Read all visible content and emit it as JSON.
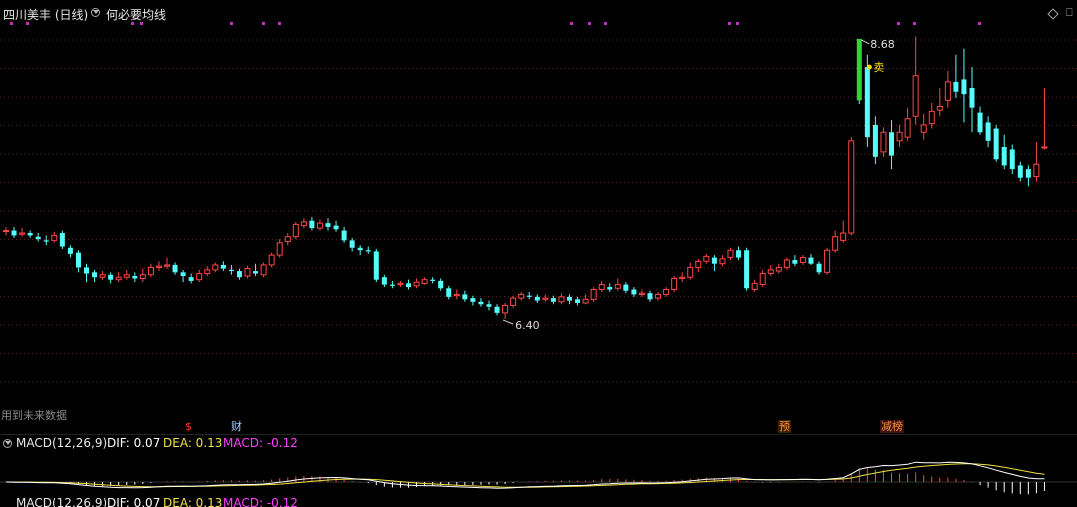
{
  "header": {
    "title": "四川美丰 (日线)",
    "indicator_name": "何必要均线"
  },
  "annotations": {
    "high_price": "8.68",
    "low_price": "6.40",
    "sell_marker": "卖",
    "future_data_note": "用到未来数据",
    "event_s": "$",
    "event_cai": "财",
    "event_yu": "预",
    "event_bang": "减榜"
  },
  "macd": {
    "name": "MACD(12,26,9)",
    "dif_label": "DIF: 0.07",
    "dea_label": "DEA: 0.13",
    "macd_label": "MACD: -0.12"
  },
  "colors": {
    "up": "#ff4545",
    "down": "#54fcfc",
    "highlight": "#2fd62f",
    "dif": "#ffffff",
    "dea": "#f0e040",
    "macd": "#ff40ff",
    "grid": "#5a2020",
    "purple_marks": "#c030c0"
  },
  "chart_data": {
    "type": "candlestick",
    "title": "四川美丰 (日线)",
    "high_label": 8.68,
    "low_label": 6.4,
    "price_range": [
      5.7,
      8.85
    ],
    "candles": [
      [
        7.12,
        7.12,
        7.15,
        7.08
      ],
      [
        7.12,
        7.08,
        7.15,
        7.06
      ],
      [
        7.09,
        7.1,
        7.14,
        7.07
      ],
      [
        7.1,
        7.08,
        7.12,
        7.06
      ],
      [
        7.07,
        7.05,
        7.1,
        7.03
      ],
      [
        7.04,
        7.03,
        7.08,
        7.0
      ],
      [
        7.04,
        7.08,
        7.11,
        7.02
      ],
      [
        7.1,
        6.99,
        7.12,
        6.97
      ],
      [
        6.98,
        6.93,
        7.0,
        6.9
      ],
      [
        6.94,
        6.82,
        6.96,
        6.78
      ],
      [
        6.82,
        6.77,
        6.85,
        6.7
      ],
      [
        6.78,
        6.74,
        6.8,
        6.7
      ],
      [
        6.74,
        6.76,
        6.79,
        6.72
      ],
      [
        6.76,
        6.72,
        6.78,
        6.69
      ],
      [
        6.72,
        6.74,
        6.78,
        6.7
      ],
      [
        6.74,
        6.76,
        6.8,
        6.72
      ],
      [
        6.75,
        6.73,
        6.78,
        6.7
      ],
      [
        6.73,
        6.76,
        6.81,
        6.7
      ],
      [
        6.76,
        6.82,
        6.85,
        6.74
      ],
      [
        6.82,
        6.83,
        6.87,
        6.79
      ],
      [
        6.83,
        6.84,
        6.9,
        6.81
      ],
      [
        6.84,
        6.78,
        6.86,
        6.76
      ],
      [
        6.78,
        6.75,
        6.8,
        6.7
      ],
      [
        6.74,
        6.71,
        6.77,
        6.69
      ],
      [
        6.72,
        6.77,
        6.8,
        6.7
      ],
      [
        6.77,
        6.8,
        6.83,
        6.75
      ],
      [
        6.8,
        6.84,
        6.86,
        6.78
      ],
      [
        6.84,
        6.81,
        6.87,
        6.79
      ],
      [
        6.8,
        6.79,
        6.84,
        6.76
      ],
      [
        6.79,
        6.74,
        6.81,
        6.72
      ],
      [
        6.75,
        6.81,
        6.83,
        6.73
      ],
      [
        6.79,
        6.77,
        6.85,
        6.75
      ],
      [
        6.76,
        6.84,
        6.86,
        6.74
      ],
      [
        6.84,
        6.92,
        6.94,
        6.82
      ],
      [
        6.92,
        7.02,
        7.05,
        6.9
      ],
      [
        7.03,
        7.07,
        7.1,
        7.0
      ],
      [
        7.07,
        7.17,
        7.19,
        7.05
      ],
      [
        7.16,
        7.19,
        7.22,
        7.14
      ],
      [
        7.2,
        7.14,
        7.23,
        7.12
      ],
      [
        7.14,
        7.18,
        7.21,
        7.12
      ],
      [
        7.18,
        7.15,
        7.22,
        7.12
      ],
      [
        7.16,
        7.13,
        7.2,
        7.11
      ],
      [
        7.12,
        7.04,
        7.15,
        7.02
      ],
      [
        7.04,
        6.98,
        7.06,
        6.95
      ],
      [
        6.98,
        6.96,
        7.0,
        6.92
      ],
      [
        6.96,
        6.95,
        6.99,
        6.93
      ],
      [
        6.95,
        6.72,
        6.97,
        6.7
      ],
      [
        6.74,
        6.68,
        6.76,
        6.66
      ],
      [
        6.68,
        6.67,
        6.71,
        6.65
      ],
      [
        6.68,
        6.69,
        6.71,
        6.66
      ],
      [
        6.69,
        6.66,
        6.72,
        6.64
      ],
      [
        6.67,
        6.7,
        6.73,
        6.65
      ],
      [
        6.69,
        6.72,
        6.74,
        6.68
      ],
      [
        6.72,
        6.71,
        6.74,
        6.69
      ],
      [
        6.71,
        6.65,
        6.73,
        6.63
      ],
      [
        6.65,
        6.58,
        6.67,
        6.56
      ],
      [
        6.59,
        6.6,
        6.64,
        6.56
      ],
      [
        6.6,
        6.56,
        6.63,
        6.54
      ],
      [
        6.57,
        6.54,
        6.59,
        6.51
      ],
      [
        6.54,
        6.52,
        6.57,
        6.5
      ],
      [
        6.52,
        6.5,
        6.55,
        6.47
      ],
      [
        6.5,
        6.45,
        6.52,
        6.43
      ],
      [
        6.45,
        6.51,
        6.53,
        6.4
      ],
      [
        6.51,
        6.57,
        6.59,
        6.49
      ],
      [
        6.57,
        6.6,
        6.62,
        6.55
      ],
      [
        6.59,
        6.58,
        6.62,
        6.56
      ],
      [
        6.58,
        6.55,
        6.6,
        6.53
      ],
      [
        6.56,
        6.57,
        6.6,
        6.54
      ],
      [
        6.57,
        6.54,
        6.59,
        6.52
      ],
      [
        6.54,
        6.58,
        6.61,
        6.52
      ],
      [
        6.58,
        6.55,
        6.6,
        6.52
      ],
      [
        6.56,
        6.53,
        6.58,
        6.51
      ],
      [
        6.53,
        6.56,
        6.6,
        6.52
      ],
      [
        6.56,
        6.64,
        6.66,
        6.54
      ],
      [
        6.64,
        6.68,
        6.71,
        6.62
      ],
      [
        6.66,
        6.64,
        6.69,
        6.62
      ],
      [
        6.65,
        6.68,
        6.73,
        6.63
      ],
      [
        6.68,
        6.63,
        6.7,
        6.61
      ],
      [
        6.64,
        6.6,
        6.66,
        6.58
      ],
      [
        6.6,
        6.61,
        6.64,
        6.58
      ],
      [
        6.61,
        6.56,
        6.63,
        6.54
      ],
      [
        6.57,
        6.6,
        6.62,
        6.55
      ],
      [
        6.6,
        6.64,
        6.66,
        6.58
      ],
      [
        6.64,
        6.73,
        6.75,
        6.62
      ],
      [
        6.73,
        6.74,
        6.78,
        6.7
      ],
      [
        6.74,
        6.82,
        6.86,
        6.72
      ],
      [
        6.82,
        6.87,
        6.89,
        6.78
      ],
      [
        6.87,
        6.91,
        6.93,
        6.85
      ],
      [
        6.9,
        6.85,
        6.92,
        6.79
      ],
      [
        6.85,
        6.89,
        6.92,
        6.83
      ],
      [
        6.9,
        6.96,
        6.98,
        6.88
      ],
      [
        6.96,
        6.9,
        6.99,
        6.88
      ],
      [
        6.96,
        6.65,
        6.98,
        6.63
      ],
      [
        6.64,
        6.69,
        6.72,
        6.62
      ],
      [
        6.68,
        6.77,
        6.8,
        6.66
      ],
      [
        6.77,
        6.8,
        6.84,
        6.75
      ],
      [
        6.79,
        6.82,
        6.85,
        6.77
      ],
      [
        6.82,
        6.88,
        6.9,
        6.8
      ],
      [
        6.88,
        6.85,
        6.92,
        6.83
      ],
      [
        6.86,
        6.9,
        6.92,
        6.84
      ],
      [
        6.9,
        6.85,
        6.93,
        6.84
      ],
      [
        6.85,
        6.78,
        6.87,
        6.76
      ],
      [
        6.78,
        6.96,
        6.98,
        6.76
      ],
      [
        6.96,
        7.07,
        7.12,
        6.94
      ],
      [
        7.04,
        7.1,
        7.2,
        7.02
      ],
      [
        7.1,
        7.85,
        7.88,
        7.08
      ],
      [
        8.68,
        8.18,
        8.68,
        8.15
      ],
      [
        8.45,
        7.88,
        8.55,
        7.8
      ],
      [
        7.98,
        7.72,
        8.05,
        7.66
      ],
      [
        7.76,
        7.92,
        7.96,
        7.72
      ],
      [
        7.92,
        7.73,
        8.02,
        7.62
      ],
      [
        7.85,
        7.92,
        7.98,
        7.8
      ],
      [
        7.88,
        8.03,
        8.12,
        7.85
      ],
      [
        8.05,
        8.38,
        8.7,
        7.98
      ],
      [
        7.92,
        7.98,
        8.07,
        7.86
      ],
      [
        7.99,
        8.09,
        8.16,
        7.95
      ],
      [
        8.1,
        8.13,
        8.28,
        8.05
      ],
      [
        8.18,
        8.33,
        8.42,
        8.12
      ],
      [
        8.33,
        8.25,
        8.55,
        8.2
      ],
      [
        8.35,
        8.23,
        8.6,
        8.0
      ],
      [
        8.28,
        8.12,
        8.45,
        7.92
      ],
      [
        8.08,
        7.92,
        8.13,
        7.9
      ],
      [
        8.0,
        7.85,
        8.05,
        7.8
      ],
      [
        7.95,
        7.7,
        7.98,
        7.68
      ],
      [
        7.8,
        7.65,
        7.9,
        7.62
      ],
      [
        7.78,
        7.62,
        7.82,
        7.58
      ],
      [
        7.65,
        7.55,
        7.68,
        7.52
      ],
      [
        7.62,
        7.55,
        7.65,
        7.48
      ],
      [
        7.56,
        7.66,
        7.84,
        7.52
      ],
      [
        7.8,
        7.8,
        8.28,
        7.78
      ]
    ],
    "macd_dif_value": 0.07,
    "macd_dea_value": 0.13,
    "macd_hist_value": -0.12
  }
}
